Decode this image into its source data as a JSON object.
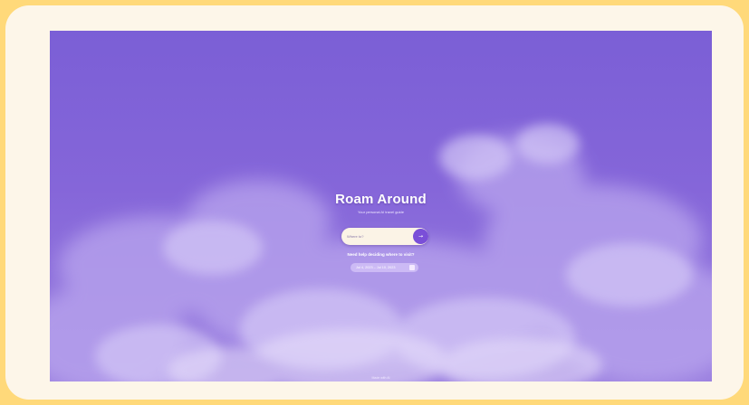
{
  "app": {
    "title": "Roam Around",
    "subtitle": "Your personal AI travel guide"
  },
  "search": {
    "placeholder": "Where to?",
    "go_icon": "arrow-right-icon"
  },
  "help": {
    "label": "Need help deciding where to visit?"
  },
  "dates": {
    "label": "Jul 4, 2023 – Jul 10, 2023",
    "icon": "calendar-icon"
  },
  "footer": {
    "text": "Made with AI"
  },
  "colors": {
    "frame": "#ffd97a",
    "card": "#fdf6e9",
    "sky": "#7b5fd6",
    "accent": "#7a4fd8"
  }
}
